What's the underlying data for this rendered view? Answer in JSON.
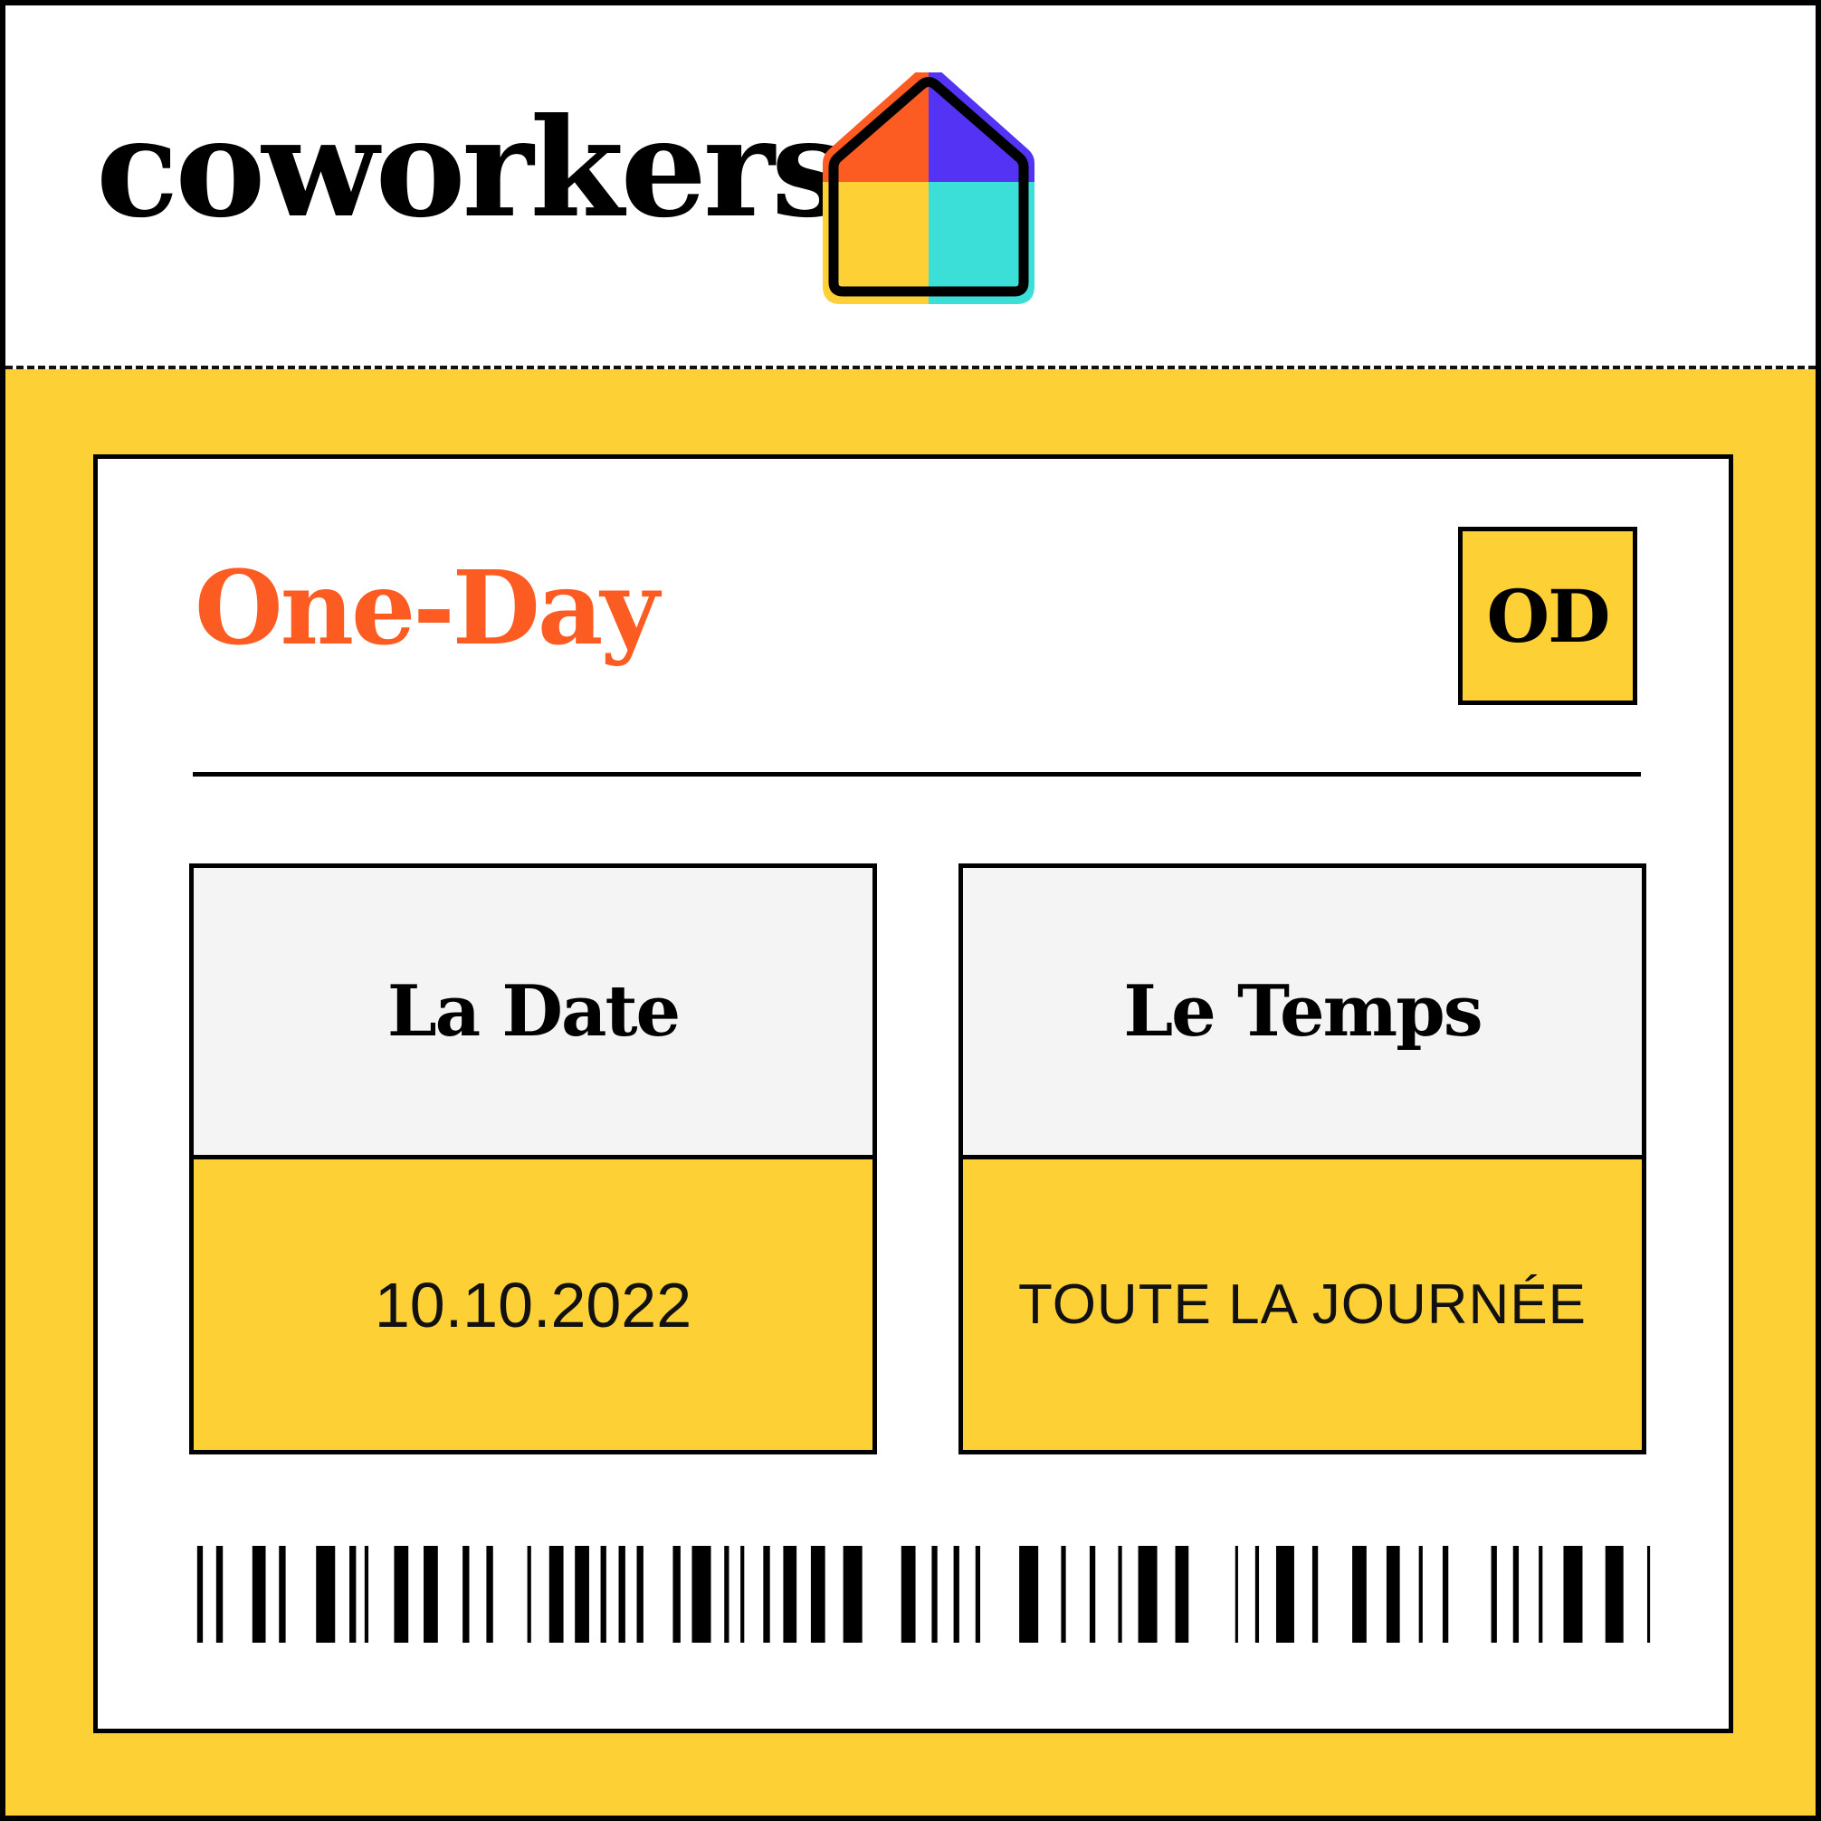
{
  "brand": {
    "name": "coworkers",
    "logo": "house-logo",
    "colors": {
      "orange": "#FC5B22",
      "purple": "#5533F5",
      "yellow": "#FDD036",
      "teal": "#3BDFD7"
    }
  },
  "ticket": {
    "title": "One-Day",
    "code": "OD",
    "date": {
      "label": "La Date",
      "value": "10.10.2022"
    },
    "time": {
      "label": "Le Temps",
      "value": "TOUTE LA JOURNÉE"
    },
    "barcode_icon": "barcode-icon"
  }
}
